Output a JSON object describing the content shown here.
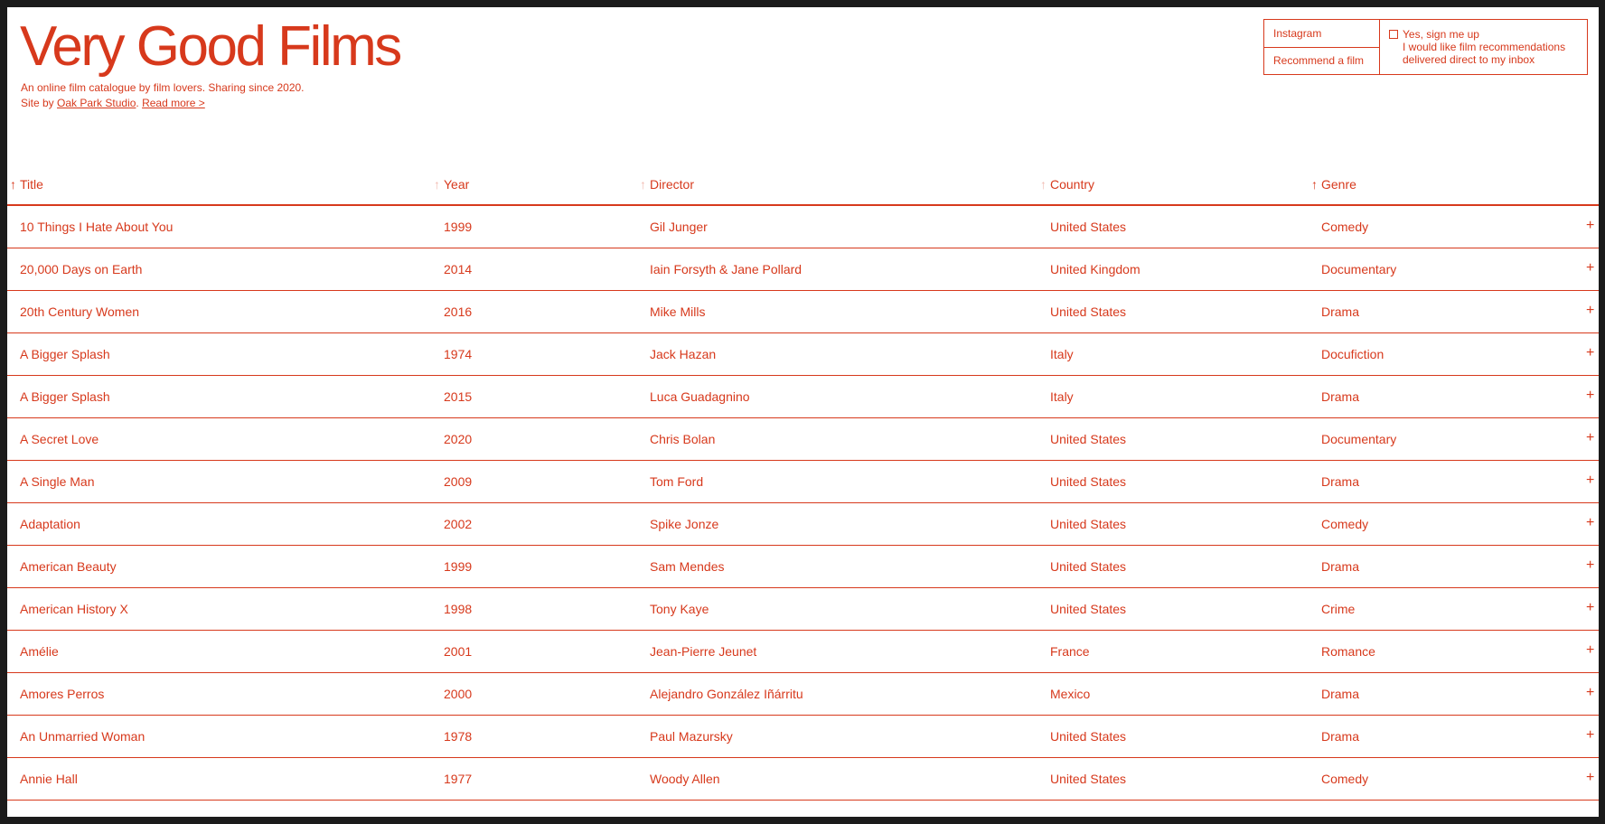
{
  "site": {
    "title": "Very Good Films",
    "tagline_line1": "An online film catalogue by film lovers. Sharing since 2020.",
    "tagline_site_by": "Site by ",
    "studio_link": "Oak Park Studio",
    "separator": ". ",
    "read_more": "Read more >"
  },
  "header_box": {
    "instagram": "Instagram",
    "recommend": "Recommend a film",
    "signup_label": "Yes, sign me up",
    "signup_desc_1": "I would like film recommendations",
    "signup_desc_2": "delivered direct to my inbox"
  },
  "table": {
    "headers": {
      "arrow": "↑",
      "title": "Title",
      "year": "Year",
      "director": "Director",
      "country": "Country",
      "genre": "Genre"
    },
    "expand_symbol": "+",
    "rows": [
      {
        "title": "10 Things I Hate About You",
        "year": "1999",
        "director": "Gil Junger",
        "country": "United States",
        "genre": "Comedy"
      },
      {
        "title": "20,000 Days on Earth",
        "year": "2014",
        "director": "Iain Forsyth & Jane Pollard",
        "country": "United Kingdom",
        "genre": "Documentary"
      },
      {
        "title": "20th Century Women",
        "year": "2016",
        "director": "Mike Mills",
        "country": "United States",
        "genre": "Drama"
      },
      {
        "title": "A Bigger Splash",
        "year": "1974",
        "director": "Jack Hazan",
        "country": "Italy",
        "genre": "Docufiction"
      },
      {
        "title": "A Bigger Splash",
        "year": "2015",
        "director": "Luca Guadagnino",
        "country": "Italy",
        "genre": "Drama"
      },
      {
        "title": "A Secret Love",
        "year": "2020",
        "director": "Chris Bolan",
        "country": "United States",
        "genre": "Documentary"
      },
      {
        "title": "A Single Man",
        "year": "2009",
        "director": "Tom Ford",
        "country": "United States",
        "genre": "Drama"
      },
      {
        "title": "Adaptation",
        "year": "2002",
        "director": "Spike Jonze",
        "country": "United States",
        "genre": "Comedy"
      },
      {
        "title": "American Beauty",
        "year": "1999",
        "director": "Sam Mendes",
        "country": "United States",
        "genre": "Drama"
      },
      {
        "title": "American History X",
        "year": "1998",
        "director": "Tony Kaye",
        "country": "United States",
        "genre": "Crime"
      },
      {
        "title": "Amélie",
        "year": "2001",
        "director": "Jean-Pierre Jeunet",
        "country": "France",
        "genre": "Romance"
      },
      {
        "title": "Amores Perros",
        "year": "2000",
        "director": "Alejandro González Iñárritu",
        "country": "Mexico",
        "genre": "Drama"
      },
      {
        "title": "An Unmarried Woman",
        "year": "1978",
        "director": "Paul Mazursky",
        "country": "United States",
        "genre": "Drama"
      },
      {
        "title": "Annie Hall",
        "year": "1977",
        "director": "Woody Allen",
        "country": "United States",
        "genre": "Comedy"
      }
    ]
  },
  "colors": {
    "accent": "#d7391c",
    "background": "#ffffff",
    "frame": "#1b1b1b"
  }
}
